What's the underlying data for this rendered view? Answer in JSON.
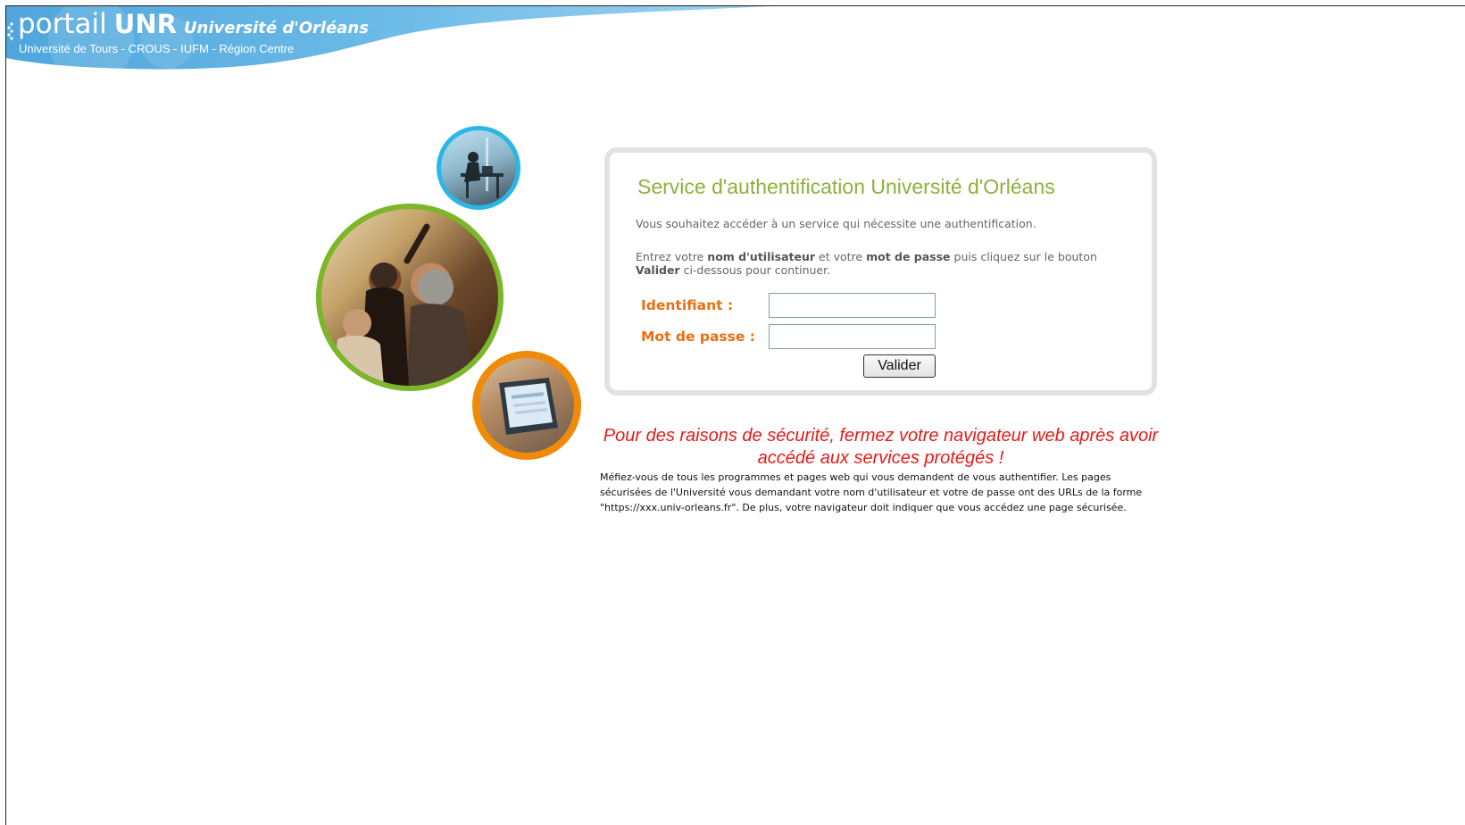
{
  "header": {
    "brand_portail": "portail",
    "brand_unr": "UNR",
    "brand_university": "Université d'Orléans",
    "subtitle": "Université de Tours - CROUS - IUFM - Région Centre"
  },
  "images": {
    "top": "student-at-computer-photo",
    "middle": "students-classroom-photo",
    "bottom": "computer-screen-photo"
  },
  "colors": {
    "banner_blue": "#59b2e3",
    "title_green": "#8db13a",
    "label_orange": "#e96f12",
    "warning_red": "#e41b17",
    "ring_blue": "#2ab7e6",
    "ring_green": "#7cb62a",
    "ring_orange": "#f08a0a"
  },
  "login": {
    "title": "Service d'authentification Université d'Orléans",
    "intro": "Vous souhaitez accéder à un service qui nécessite une authentification.",
    "instructions": {
      "part1": "Entrez votre ",
      "bold1": "nom d'utilisateur",
      "part2": " et votre ",
      "bold2": "mot de passe",
      "part3": " puis cliquez sur le bouton ",
      "bold3": "Valider",
      "part4": " ci-dessous pour continuer."
    },
    "username_label": "Identifiant :",
    "username_value": "",
    "password_label": "Mot de passe :",
    "password_value": "",
    "submit_label": "Valider"
  },
  "security": {
    "warning": "Pour des raisons de sécurité, fermez votre navigateur web après avoir accédé aux services protégés !",
    "advice": "Méfiez-vous de tous les programmes et pages web qui vous demandent de vous authentifier. Les pages sécurisées de l'Université vous demandant votre nom d'utilisateur et votre de passe ont des URLs de la forme \"https://xxx.univ-orleans.fr\". De plus, votre navigateur doit indiquer que vous accédez une page sécurisée."
  }
}
